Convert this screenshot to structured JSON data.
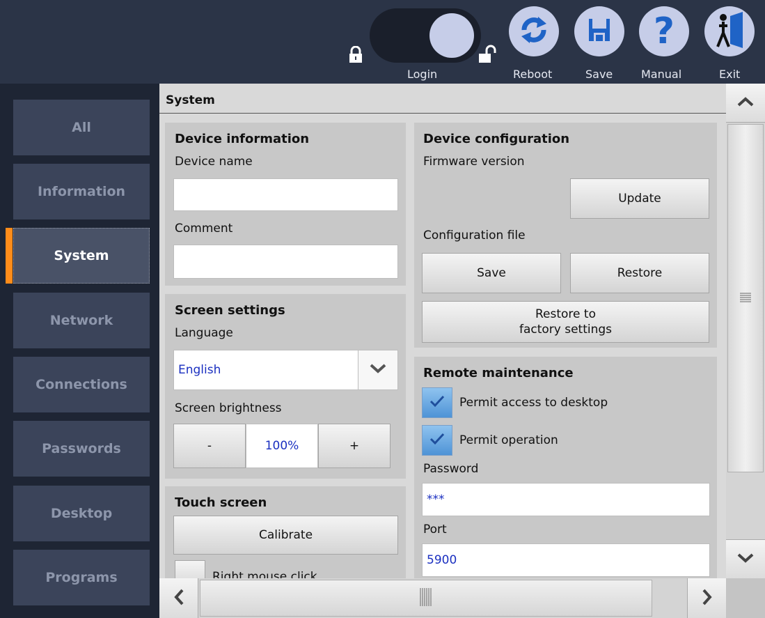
{
  "topbar": {
    "login_label": "Login",
    "reboot_label": "Reboot",
    "save_label": "Save",
    "manual_label": "Manual",
    "exit_label": "Exit",
    "manual_glyph": "?"
  },
  "sidebar": {
    "items": [
      {
        "label": "All"
      },
      {
        "label": "Information"
      },
      {
        "label": "System"
      },
      {
        "label": "Network"
      },
      {
        "label": "Connections"
      },
      {
        "label": "Passwords"
      },
      {
        "label": "Desktop"
      },
      {
        "label": "Programs"
      }
    ],
    "active": "System",
    "accent_color": "#ff8c1a"
  },
  "page": {
    "title": "System"
  },
  "device_info": {
    "title": "Device information",
    "name_label": "Device name",
    "name_value": "",
    "comment_label": "Comment",
    "comment_value": ""
  },
  "screen_settings": {
    "title": "Screen settings",
    "language_label": "Language",
    "language_value": "English",
    "brightness_label": "Screen brightness",
    "brightness_minus": "-",
    "brightness_value": "100%",
    "brightness_plus": "+"
  },
  "touch_screen": {
    "title": "Touch screen",
    "calibrate_label": "Calibrate",
    "right_click_label": "Right mouse click"
  },
  "device_config": {
    "title": "Device configuration",
    "firmware_label": "Firmware version",
    "update_label": "Update",
    "config_file_label": "Configuration file",
    "save_label": "Save",
    "restore_label": "Restore",
    "factory_line1": "Restore to",
    "factory_line2": "factory settings"
  },
  "remote": {
    "title": "Remote maintenance",
    "permit_desktop_label": "Permit access to desktop",
    "permit_operation_label": "Permit operation",
    "password_label": "Password",
    "password_value": "***",
    "port_label": "Port",
    "port_value": "5900"
  }
}
